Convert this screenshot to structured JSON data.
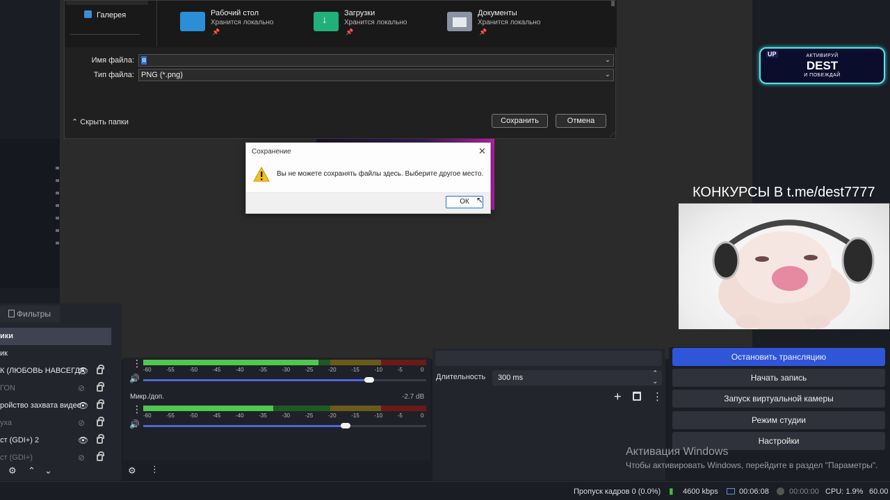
{
  "save_dialog": {
    "nav_gallery": "Галерея",
    "folders": [
      {
        "name": "Рабочий стол",
        "status": "Хранится локально",
        "color": "#2a8fd6"
      },
      {
        "name": "Загрузки",
        "status": "Хранится локально",
        "color": "#22b07a"
      },
      {
        "name": "Документы",
        "status": "Хранится локально",
        "color": "#8a93a3"
      }
    ],
    "filename_label": "Имя файла:",
    "filename_value": "я",
    "filetype_label": "Тип файла:",
    "filetype_value": "PNG (*.png)",
    "hide_folders": "Скрыть папки",
    "save_button": "Сохранить",
    "cancel_button": "Отмена"
  },
  "error_dialog": {
    "title": "Сохранение",
    "message": "Вы не можете сохранять файлы здесь. Выберите другое место.",
    "ok_button": "ОК"
  },
  "overlay": {
    "promo_badge": "UP",
    "promo_top": "АКТИВИРУЙ",
    "promo_main": "DEST",
    "promo_bottom": "И ПОБЕЖДАЙ",
    "contest_text": "КОНКУРСЫ В t.me/dest7777"
  },
  "obs": {
    "filters_tab": "Фильтры",
    "sources": [
      {
        "label": "ики",
        "selected": true,
        "visible": null
      },
      {
        "label": "ик",
        "selected": false,
        "visible": null
      },
      {
        "label": "К (ЛЮБОВЬ НАВСЕГДА",
        "selected": false,
        "visible": true
      },
      {
        "label": "ГОN",
        "selected": false,
        "visible": false
      },
      {
        "label": "ройство захвата видео",
        "selected": false,
        "visible": true
      },
      {
        "label": "уха",
        "selected": false,
        "visible": false
      },
      {
        "label": "ст (GDI+) 2",
        "selected": false,
        "visible": true
      },
      {
        "label": "ст (GDI+)",
        "selected": false,
        "visible": false
      }
    ],
    "mixer": {
      "scale": [
        "-60",
        "-55",
        "-50",
        "-45",
        "-40",
        "-35",
        "-30",
        "-25",
        "-20",
        "-15",
        "-10",
        "-5",
        "0"
      ],
      "channels": [
        {
          "name": "",
          "db": "",
          "level": 0.62,
          "volume": 0.95
        },
        {
          "name": "Микр./доп.",
          "db": "-2.7 dB",
          "level": 0.46,
          "volume": 0.85
        }
      ]
    },
    "transition": {
      "duration_label": "Длительность",
      "duration_value": "300 ms"
    },
    "controls": {
      "stop_stream": "Остановить трансляцию",
      "start_record": "Начать запись",
      "virtual_cam": "Запуск виртуальной камеры",
      "studio_mode": "Режим студии",
      "settings": "Настройки"
    },
    "status": {
      "dropped_frames": "Пропуск кадров 0 (0.0%)",
      "bitrate": "4600 kbps",
      "stream_time": "00:06:08",
      "record_time": "00:00:00",
      "cpu": "CPU: 1.9%",
      "fps": "60.00"
    }
  },
  "windows_activation": {
    "title": "Активация Windows",
    "subtitle": "Чтобы активировать Windows, перейдите в раздел \"Параметры\"."
  },
  "colors": {
    "accent_blue": "#2f56d9",
    "meter_green": "#4ec94e",
    "promo_border": "#54e3e8"
  }
}
